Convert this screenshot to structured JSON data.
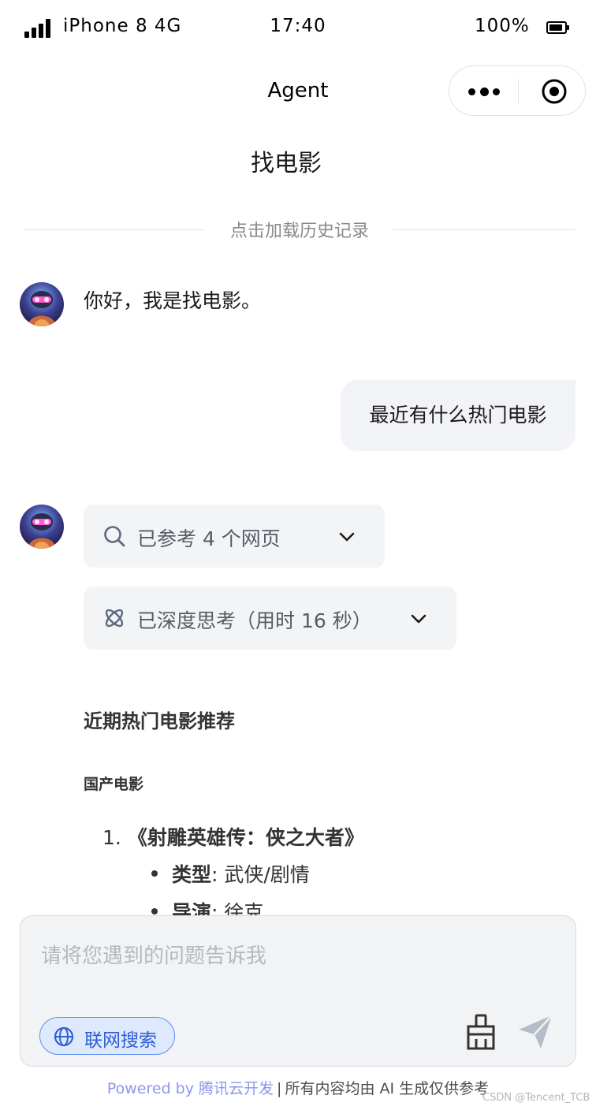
{
  "status_bar": {
    "carrier": "iPhone 8  4G",
    "time": "17:40",
    "battery": "100%"
  },
  "nav": {
    "title": "Agent"
  },
  "page": {
    "heading": "找电影",
    "load_history": "点击加载历史记录"
  },
  "chat": {
    "greeting": "你好，我是找电影。",
    "user_message": "最近有什么热门电影",
    "references_label": "已参考 4 个网页",
    "thinking_label": "已深度思考（用时 16 秒）",
    "answer": {
      "heading": "近期热门电影推荐",
      "subheading": "国产电影",
      "item_number": "1.",
      "item_title": "《射雕英雄传：侠之大者》",
      "genre_key": "类型",
      "genre_value": ": 武侠/剧情",
      "director_key": "导演",
      "director_value": ": 徐克"
    }
  },
  "composer": {
    "placeholder": "请将您遇到的问题告诉我",
    "web_search_label": "联网搜索"
  },
  "footer": {
    "powered_by": "Powered by 腾讯云开发",
    "separator": "|",
    "disclaimer": "所有内容均由 AI 生成仅供参考",
    "watermark": "CSDN @Tencent_TCB"
  },
  "colors": {
    "accent_blue": "#2f5fd4",
    "powered_purple": "#8f95ec",
    "bubble_bg": "#f2f3f7",
    "pill_bg": "#f3f4f6"
  },
  "icons": [
    "signal-icon",
    "battery-icon",
    "more-icon",
    "target-icon",
    "search-icon",
    "atom-icon",
    "chevron-down-icon",
    "globe-icon",
    "brush-icon",
    "send-icon"
  ]
}
